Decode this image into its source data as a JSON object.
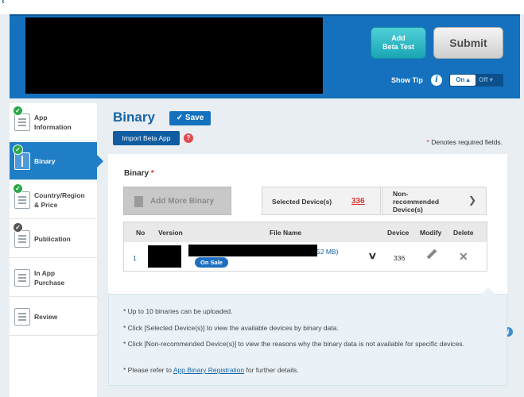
{
  "header": {
    "add_beta_test_label": "Add\nBeta Test",
    "add_beta_line1": "Add",
    "add_beta_line2": "Beta Test",
    "submit_label": "Submit",
    "show_tip_label": "Show Tip",
    "tip_on": "On",
    "tip_off": "Off"
  },
  "sidebar": {
    "items": [
      {
        "line1": "App",
        "line2": "Information",
        "status": "complete"
      },
      {
        "line1": "Binary",
        "line2": "",
        "status": "complete",
        "active": true
      },
      {
        "line1": "Country/Region",
        "line2": "& Price",
        "status": "complete"
      },
      {
        "line1": "Publication",
        "line2": "",
        "status": "pending"
      },
      {
        "line1": "In App",
        "line2": "Purchase",
        "status": ""
      },
      {
        "line1": "Review",
        "line2": "",
        "status": ""
      }
    ]
  },
  "main": {
    "title": "Binary",
    "save_label": "Save",
    "import_label": "Import Beta App",
    "required_note": "Denotes required fields.",
    "required_star": "*"
  },
  "binary": {
    "section_title": "Binary",
    "add_more_label": "Add More Binary",
    "selected_devices_label": "Selected Device(s)",
    "selected_devices_count": "336",
    "nonrecommended_line1": "Non-",
    "nonrecommended_line2": "recommended",
    "nonrecommended_line3": "Device(s)",
    "columns": [
      "No",
      "Version",
      "File Name",
      "Device",
      "Modify",
      "Delete"
    ],
    "rows": [
      {
        "no": "1",
        "size": "52 MB)",
        "status_badge": "On Sale",
        "device": "336"
      }
    ]
  },
  "notes": {
    "note1": "* Up to 10 binaries can be uploaded.",
    "note2": "* Click [Selected Device(s)] to view the available devices by binary data.",
    "note3": "* Click [Non-recommended Device(s)] to view the reasons why the binary data is not available for specific devices.",
    "note4_prefix": "* Please refer to ",
    "note4_link": "App Binary Registration",
    "note4_suffix": " for further details."
  },
  "colors": {
    "brand_blue": "#1571bd",
    "beta_button": "#1aa5b3",
    "complete_check": "#2aa84a",
    "required_red": "#dd3333"
  }
}
